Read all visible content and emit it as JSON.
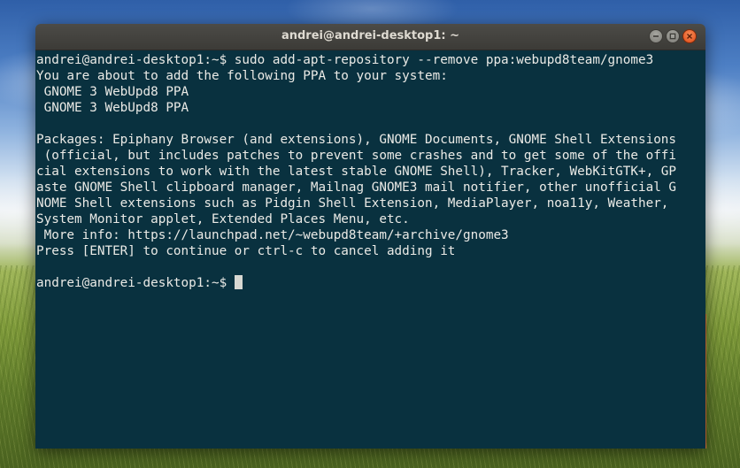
{
  "window": {
    "title": "andrei@andrei-desktop1: ~",
    "controls": {
      "minimize_icon": "minimize-icon",
      "maximize_icon": "maximize-icon",
      "close_icon": "close-icon"
    }
  },
  "terminal": {
    "background_color": "#09313f",
    "text_color": "#eaeae6",
    "lines": [
      "andrei@andrei-desktop1:~$ sudo add-apt-repository --remove ppa:webupd8team/gnome3",
      "You are about to add the following PPA to your system:",
      " GNOME 3 WebUpd8 PPA",
      " GNOME 3 WebUpd8 PPA",
      "",
      "Packages: Epiphany Browser (and extensions), GNOME Documents, GNOME Shell Extensions",
      " (official, but includes patches to prevent some crashes and to get some of the offi",
      "cial extensions to work with the latest stable GNOME Shell), Tracker, WebKitGTK+, GP",
      "aste GNOME Shell clipboard manager, Mailnag GNOME3 mail notifier, other unofficial G",
      "NOME Shell extensions such as Pidgin Shell Extension, MediaPlayer, noa11y, Weather,",
      "System Monitor applet, Extended Places Menu, etc.",
      " More info: https://launchpad.net/~webupd8team/+archive/gnome3",
      "Press [ENTER] to continue or ctrl-c to cancel adding it",
      ""
    ],
    "prompt": "andrei@andrei-desktop1:~$ "
  },
  "colors": {
    "titlebar": "#3c3b37",
    "close_button": "#df4a16",
    "accent_edge": "#e6753a"
  }
}
